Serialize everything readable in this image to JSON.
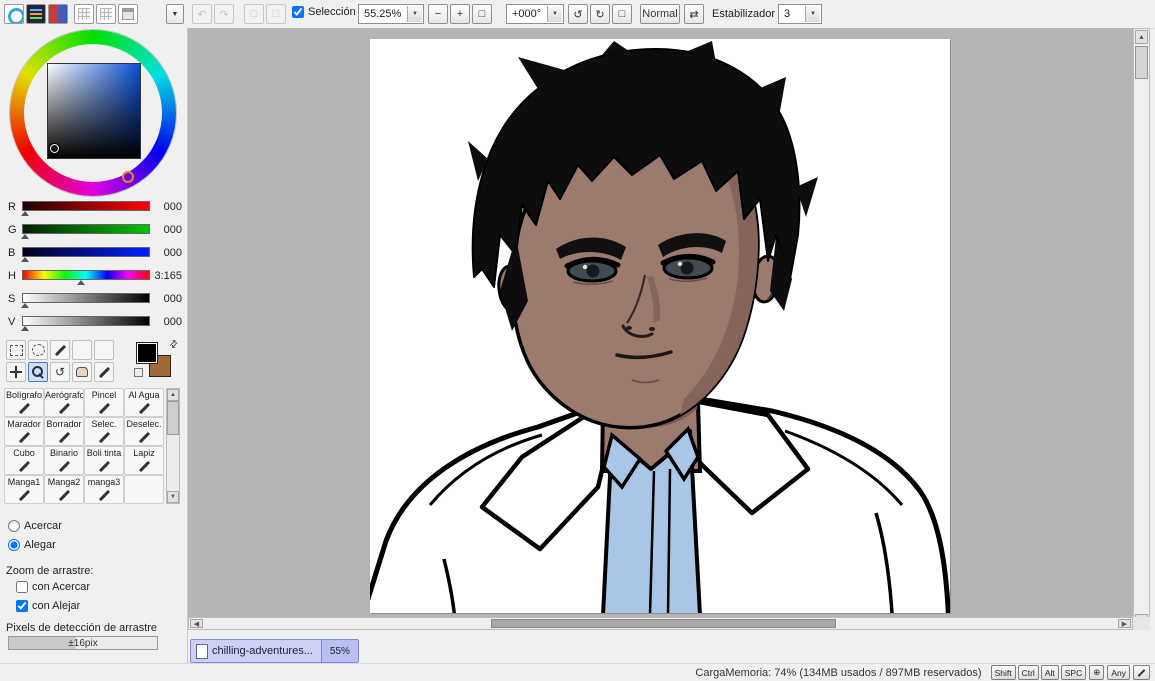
{
  "toolbar": {
    "seleccion_label": "Selección",
    "zoom": {
      "value": "55.25%"
    },
    "rotation": {
      "value": "+000°"
    },
    "blend_label": "Normal",
    "estabilizador_label": "Estabilizador",
    "estabilizador_value": "3"
  },
  "icons": {
    "arrow_down": "▼",
    "arrow_up": "▲",
    "arrow_left": "◀",
    "arrow_right": "▶",
    "undo": "↶",
    "redo": "↷",
    "minus": "−",
    "plus": "+",
    "rotate_ccw": "↺",
    "rotate_cw": "↻",
    "flip": "⇄",
    "reset": "□",
    "target": "⊕"
  },
  "color_panel": {
    "sliders": [
      {
        "label": "R",
        "value": "000",
        "pos": 0.02
      },
      {
        "label": "G",
        "value": "000",
        "pos": 0.02
      },
      {
        "label": "B",
        "value": "000",
        "pos": 0.02
      },
      {
        "label": "H",
        "value": "3:165",
        "pos": 0.46
      },
      {
        "label": "S",
        "value": "000",
        "pos": 0.02
      },
      {
        "label": "V",
        "value": "000",
        "pos": 0.02
      }
    ]
  },
  "toolgrid": {
    "cells": [
      "Bolígrafo",
      "Aerógrafo",
      "Pincel",
      "Al Agua",
      "Marador",
      "Borrador",
      "Selec.",
      "Deselec.",
      "Cubo",
      "Binario",
      "Boli tinta",
      "Lapiz",
      "Manga1",
      "Manga2",
      "manga3",
      ""
    ]
  },
  "zoom_panel": {
    "radio_in": "Acercar",
    "radio_out": "Alegar",
    "drag_title": "Zoom de arrastre:",
    "check_in": "con Acercar",
    "check_out": "con Alejar",
    "pixels_label": "Pixels de detección de arrastre",
    "pixels_value": "±16pix"
  },
  "document_tab": {
    "title": "chilling-adventures...",
    "zoom": "55%"
  },
  "status_bar": {
    "memory": "CargaMemoria: 74% (134MB usados / 897MB reservados)",
    "keys": [
      "Shift",
      "Ctrl",
      "Alt",
      "SPC"
    ],
    "any_label": "Any"
  },
  "artwork_colors": {
    "skin": "#9d7a6e",
    "skin_shadow": "#85645b",
    "neck_shadow": "#7c5a50",
    "hair": "#0d0d10",
    "shirt_blue": "#a9c6e6",
    "jacket": "#ffffff"
  }
}
